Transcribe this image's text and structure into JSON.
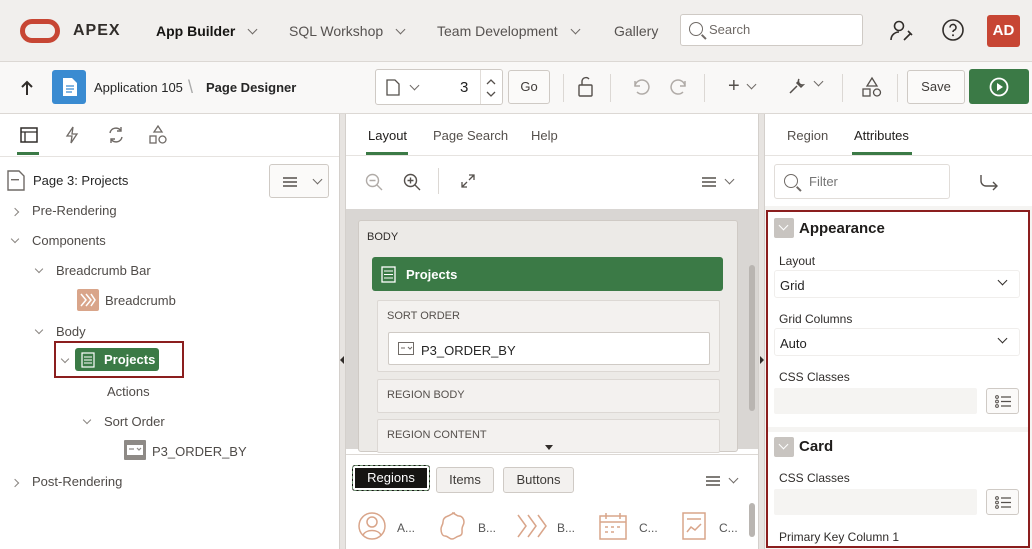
{
  "header": {
    "brand": "APEX",
    "nav": [
      {
        "label": "App Builder",
        "active": true
      },
      {
        "label": "SQL Workshop"
      },
      {
        "label": "Team Development"
      },
      {
        "label": "Gallery"
      }
    ],
    "search_placeholder": "Search",
    "user_initials": "AD",
    "accent_color": "#c74634"
  },
  "toolbar": {
    "breadcrumb_app": "Application 105",
    "breadcrumb_page": "Page Designer",
    "page_number": "3",
    "go_label": "Go",
    "save_label": "Save",
    "run_color": "#3b7a46"
  },
  "left": {
    "page_title": "Page 3: Projects",
    "tree": {
      "pre_rendering": "Pre-Rendering",
      "components": "Components",
      "breadcrumb_bar": "Breadcrumb Bar",
      "breadcrumb": "Breadcrumb",
      "body": "Body",
      "projects": "Projects",
      "actions": "Actions",
      "sort_order": "Sort Order",
      "p3_order_by": "P3_ORDER_BY",
      "post_rendering": "Post-Rendering"
    }
  },
  "middle": {
    "tabs": [
      "Layout",
      "Page Search",
      "Help"
    ],
    "body_label": "BODY",
    "region_title": "Projects",
    "sort_order_label": "SORT ORDER",
    "item_label": "P3_ORDER_BY",
    "region_body_label": "REGION BODY",
    "region_content_label": "REGION CONTENT",
    "gallery_tabs": [
      "Regions",
      "Items",
      "Buttons"
    ],
    "gallery_items": [
      "A...",
      "B...",
      "B...",
      "C...",
      "C..."
    ]
  },
  "right": {
    "tabs": [
      "Region",
      "Attributes"
    ],
    "filter_placeholder": "Filter",
    "appearance": {
      "heading": "Appearance",
      "layout_label": "Layout",
      "layout_value": "Grid",
      "grid_columns_label": "Grid Columns",
      "grid_columns_value": "Auto",
      "css_classes_label": "CSS Classes"
    },
    "card": {
      "heading": "Card",
      "css_classes_label": "CSS Classes",
      "primary_key_label": "Primary Key Column 1"
    }
  }
}
